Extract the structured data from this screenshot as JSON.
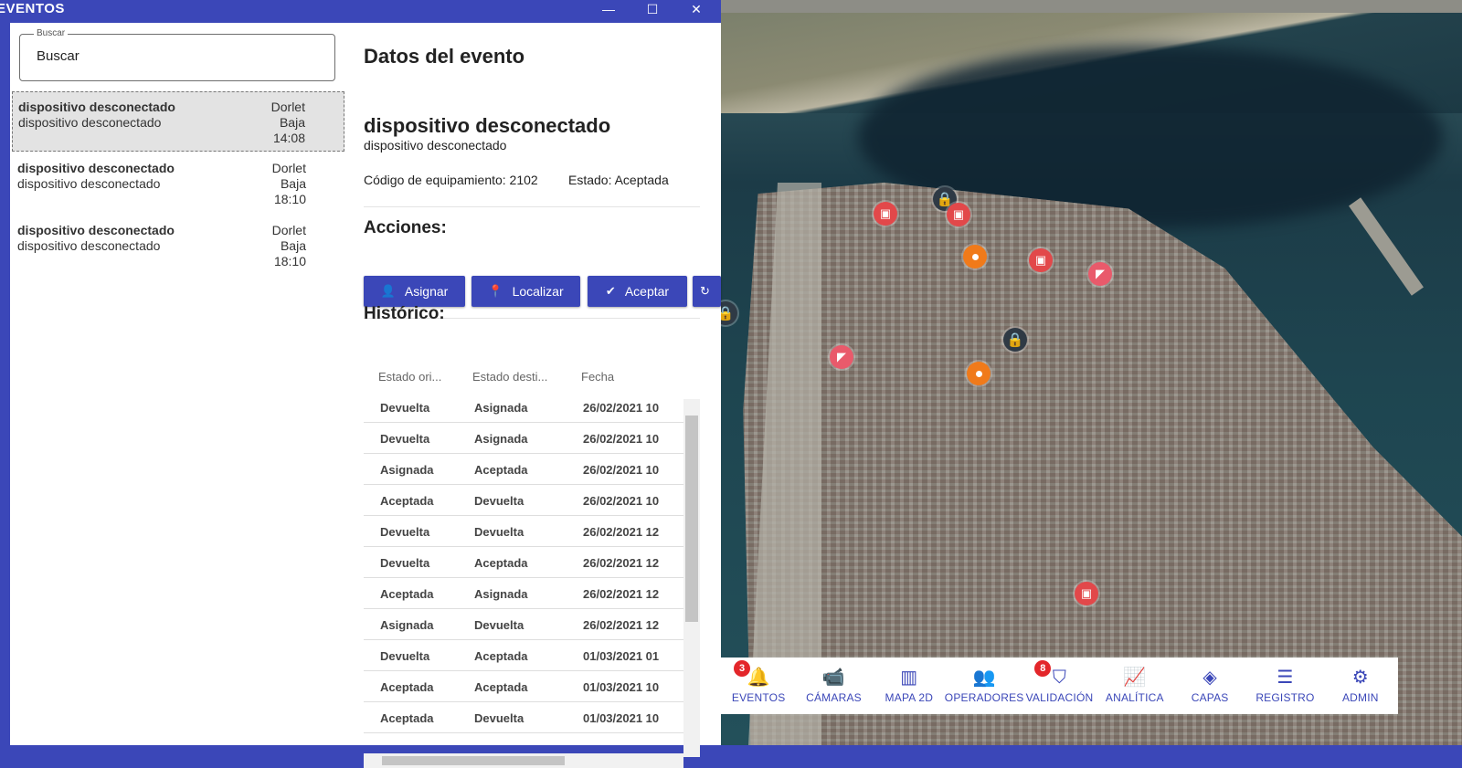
{
  "window": {
    "title": "EVENTOS",
    "minimize": "—",
    "maximize": "☐",
    "close": "✕"
  },
  "search": {
    "label": "Buscar",
    "value": "Buscar"
  },
  "events": [
    {
      "title": "dispositivo desconectado",
      "subtitle": "dispositivo desconectado",
      "source": "Dorlet",
      "priority": "Baja",
      "time": "14:08"
    },
    {
      "title": "dispositivo desconectado",
      "subtitle": "dispositivo desconectado",
      "source": "Dorlet",
      "priority": "Baja",
      "time": "18:10"
    },
    {
      "title": "dispositivo desconectado",
      "subtitle": "dispositivo desconectado",
      "source": "Dorlet",
      "priority": "Baja",
      "time": "18:10"
    }
  ],
  "details": {
    "heading": "Datos del evento",
    "event_title": "dispositivo desconectado",
    "event_subtitle": "dispositivo desconectado",
    "equipment": "Código de equipamiento: 2102",
    "state": "Estado: Aceptada",
    "actions_heading": "Acciones:",
    "actions": {
      "assign": "Asignar",
      "locate": "Localizar",
      "accept": "Aceptar"
    },
    "history_heading": "Histórico:",
    "history_columns": [
      "Estado ori...",
      "Estado desti...",
      "Fecha"
    ],
    "history_rows": [
      [
        "Devuelta",
        "Asignada",
        "26/02/2021 10"
      ],
      [
        "Devuelta",
        "Asignada",
        "26/02/2021 10"
      ],
      [
        "Asignada",
        "Aceptada",
        "26/02/2021 10"
      ],
      [
        "Aceptada",
        "Devuelta",
        "26/02/2021 10"
      ],
      [
        "Devuelta",
        "Devuelta",
        "26/02/2021 12"
      ],
      [
        "Devuelta",
        "Aceptada",
        "26/02/2021 12"
      ],
      [
        "Aceptada",
        "Asignada",
        "26/02/2021 12"
      ],
      [
        "Asignada",
        "Devuelta",
        "26/02/2021 12"
      ],
      [
        "Devuelta",
        "Aceptada",
        "01/03/2021 01"
      ],
      [
        "Aceptada",
        "Aceptada",
        "01/03/2021 10"
      ],
      [
        "Aceptada",
        "Devuelta",
        "01/03/2021 10"
      ]
    ]
  },
  "nav": {
    "eventos": {
      "label": "EVENTOS",
      "badge": "3"
    },
    "camaras": {
      "label": "CÁMARAS"
    },
    "mapa2d": {
      "label": "MAPA 2D"
    },
    "operadores": {
      "label": "OPERADORES"
    },
    "validacion": {
      "label": "VALIDACIÓN",
      "badge": "8"
    },
    "analitica": {
      "label": "ANALÍTICA"
    },
    "capas": {
      "label": "CAPAS"
    },
    "registro": {
      "label": "REGISTRO"
    },
    "admin": {
      "label": "ADMIN"
    }
  },
  "colors": {
    "primary": "#3b47b8",
    "badge": "#e3262a",
    "marker_red": "#e2484a",
    "marker_orange": "#f07a1a"
  },
  "icons": {
    "assign": "person-add-icon",
    "locate": "map-pin-icon",
    "accept": "check-circle-icon",
    "eventos": "bell-icon",
    "camaras": "cctv-camera-icon",
    "mapa2d": "map-icon",
    "operadores": "group-icon",
    "validacion": "shield-check-icon",
    "analitica": "analytics-icon",
    "capas": "layers-icon",
    "registro": "list-icon",
    "admin": "admin-settings-icon"
  }
}
